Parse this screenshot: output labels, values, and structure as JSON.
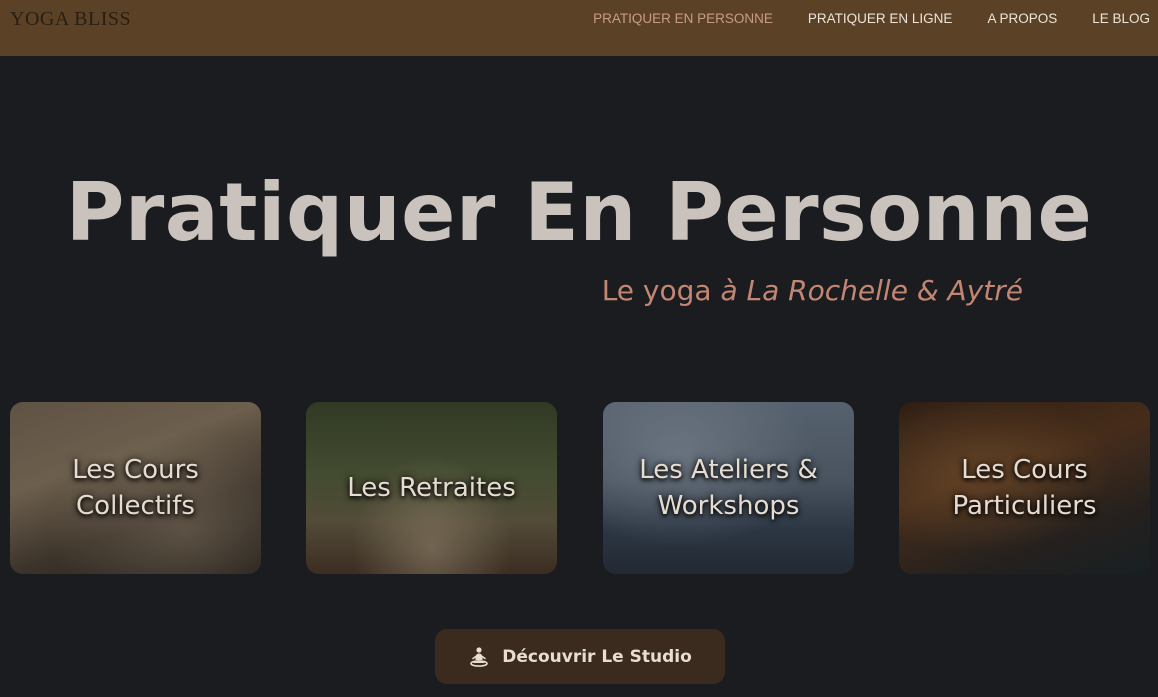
{
  "header": {
    "logo": "YOGA BLISS",
    "nav": [
      {
        "label": "PRATIQUER EN PERSONNE",
        "active": true
      },
      {
        "label": "PRATIQUER EN LIGNE",
        "active": false
      },
      {
        "label": "A PROPOS",
        "active": false
      },
      {
        "label": "LE BLOG",
        "active": false
      }
    ]
  },
  "hero": {
    "title": "Pratiquer En Personne",
    "subtitle_plain": "Le yoga ",
    "subtitle_italic": "à La Rochelle & Aytré"
  },
  "cards": [
    {
      "label": "Les Cours Collectifs"
    },
    {
      "label": "Les Retraites"
    },
    {
      "label": "Les Ateliers & Workshops"
    },
    {
      "label": "Les Cours Particuliers"
    }
  ],
  "cta": {
    "label": "Découvrir Le Studio",
    "icon": "meditation-icon"
  },
  "colors": {
    "header_bg": "#5b4227",
    "page_bg": "#1b1c1f",
    "accent": "#c38672",
    "nav_active": "#c99b87",
    "cta_bg": "#3b2b1f"
  }
}
